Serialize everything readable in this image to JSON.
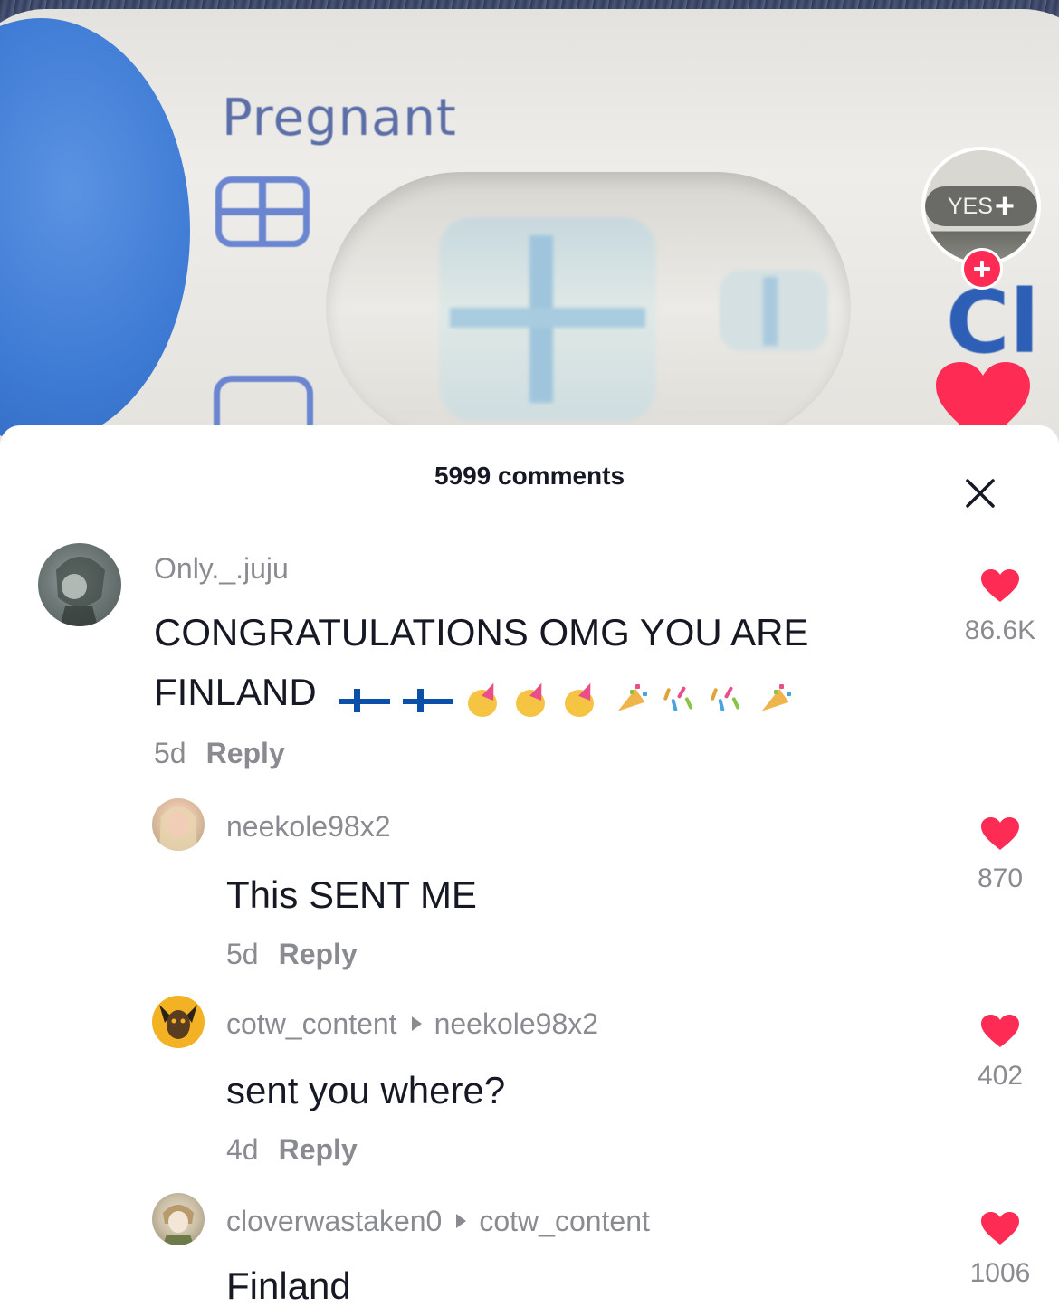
{
  "video": {
    "test_label": "Pregnant",
    "logo_fragment": "Cl",
    "creator_avatar_text": "YES",
    "creator_avatar_plus": "+"
  },
  "colors": {
    "accent": "#fe2c55",
    "text_primary": "#161823",
    "text_secondary": "#8a8b91",
    "sheet_bg": "#ffffff"
  },
  "icons": {
    "close": "close-icon",
    "like": "heart-icon",
    "follow": "plus-icon",
    "reply_arrow": "triangle-right-icon"
  },
  "sheet": {
    "title": "5999 comments"
  },
  "comments": [
    {
      "username": "Only._.juju",
      "reply_to": "",
      "text": "CONGRATULATIONS OMG YOU ARE FINLAND",
      "emojis": "🇫🇮🇫🇮🥳🥳🥳🎉🎊🎊🎉",
      "age": "5d",
      "reply_label": "Reply",
      "likes": "86.6K"
    },
    {
      "username": "neekole98x2",
      "reply_to": "",
      "text": "This SENT ME",
      "age": "5d",
      "reply_label": "Reply",
      "likes": "870"
    },
    {
      "username": "cotw_content",
      "reply_to": "neekole98x2",
      "text": "sent you where?",
      "age": "4d",
      "reply_label": "Reply",
      "likes": "402"
    },
    {
      "username": "cloverwastaken0",
      "reply_to": "cotw_content",
      "text": "Finland",
      "age": "",
      "reply_label": "",
      "likes": "1006"
    }
  ]
}
